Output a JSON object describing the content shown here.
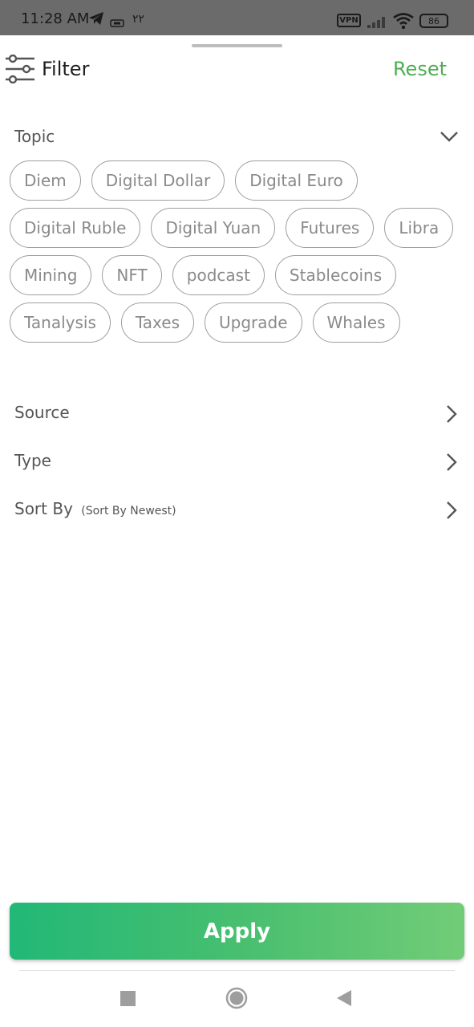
{
  "status_bar": {
    "time": "11:28 AM",
    "extra": "۲۲",
    "vpn": "VPN",
    "battery": "86",
    "icons": [
      "telegram-icon",
      "sim-icon",
      "vpn-icon",
      "signal-icon",
      "wifi-icon",
      "battery-icon"
    ]
  },
  "header": {
    "icon": "filter-sliders-icon",
    "title": "Filter",
    "reset_label": "Reset",
    "accent_color": "#4CAF50"
  },
  "topic": {
    "label": "Topic",
    "expanded": true,
    "chips": [
      "Diem",
      "Digital Dollar",
      "Digital Euro",
      "Digital Ruble",
      "Digital Yuan",
      "Futures",
      "Libra",
      "Mining",
      "NFT",
      "podcast",
      "Stablecoins",
      "Tanalysis",
      "Taxes",
      "Upgrade",
      "Whales"
    ]
  },
  "source": {
    "label": "Source"
  },
  "type": {
    "label": "Type"
  },
  "sort_by": {
    "label": "Sort By",
    "sub": "(Sort By Newest)"
  },
  "apply": {
    "label": "Apply",
    "gradient": [
      "#22B877",
      "#72CC77"
    ]
  },
  "nav": {
    "icons": [
      "recents-square-icon",
      "home-circle-icon",
      "back-triangle-icon"
    ]
  }
}
